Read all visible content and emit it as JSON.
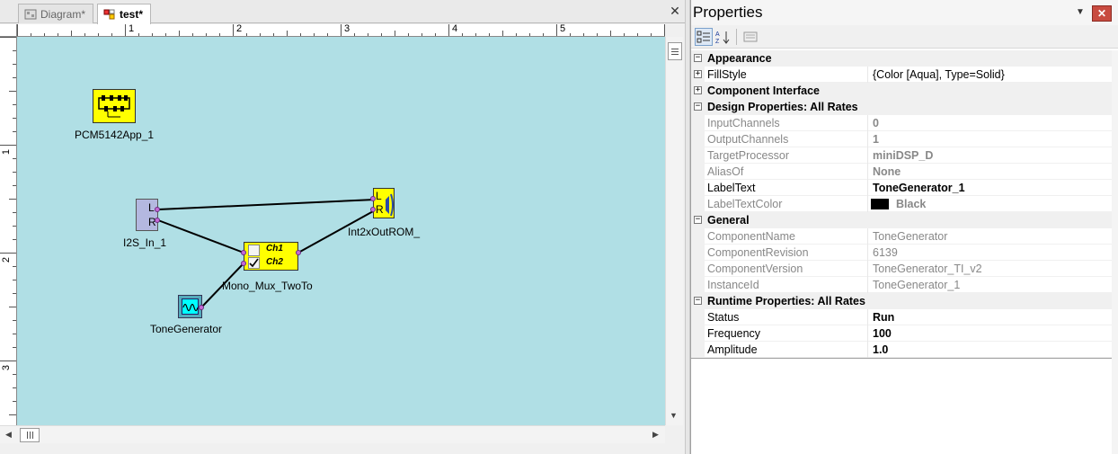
{
  "tabs": [
    {
      "label": "Diagram*",
      "active": false
    },
    {
      "label": "test*",
      "active": true
    }
  ],
  "rulers": {
    "horizontal": [
      "1",
      "2",
      "3",
      "4",
      "5"
    ],
    "vertical": [
      "1",
      "2",
      "3"
    ]
  },
  "diagram": {
    "nodes": {
      "pcm": {
        "label": "PCM5142App_1"
      },
      "i2s": {
        "label": "I2S_In_1",
        "port_l": "L",
        "port_r": "R"
      },
      "out": {
        "label": "Int2xOutROM_",
        "port_l": "L",
        "port_r": "R"
      },
      "mux": {
        "label": "Mono_Mux_TwoTo",
        "ch1": "Ch1",
        "ch2": "Ch2",
        "ch1_checked": false,
        "ch2_checked": true
      },
      "tone": {
        "label": "ToneGenerator"
      }
    },
    "canvas_color": "#b0dfe5",
    "block_color": "#ffff00"
  },
  "properties": {
    "title": "Properties",
    "categories": [
      {
        "name": "Appearance",
        "expanded": true,
        "rows": [
          {
            "name": "FillStyle",
            "value": "{Color [Aqua], Type=Solid}",
            "readonly": false,
            "bold": false,
            "expandable": true
          }
        ]
      },
      {
        "name": "Component Interface",
        "expanded": false,
        "rows": []
      },
      {
        "name": "Design Properties: All Rates",
        "expanded": true,
        "rows": [
          {
            "name": "InputChannels",
            "value": "0",
            "readonly": true,
            "bold": true
          },
          {
            "name": "OutputChannels",
            "value": "1",
            "readonly": true,
            "bold": true
          },
          {
            "name": "TargetProcessor",
            "value": "miniDSP_D",
            "readonly": true,
            "bold": true
          },
          {
            "name": "AliasOf",
            "value": "None",
            "readonly": true,
            "bold": true
          },
          {
            "name": "LabelText",
            "value": "ToneGenerator_1",
            "readonly": false,
            "bold": true
          },
          {
            "name": "LabelTextColor",
            "value": "Black",
            "readonly": true,
            "bold": true,
            "swatch": "#000000"
          }
        ]
      },
      {
        "name": "General",
        "expanded": true,
        "rows": [
          {
            "name": "ComponentName",
            "value": "ToneGenerator",
            "readonly": true,
            "bold": false
          },
          {
            "name": "ComponentRevision",
            "value": "6139",
            "readonly": true,
            "bold": false
          },
          {
            "name": "ComponentVersion",
            "value": "ToneGenerator_TI_v2",
            "readonly": true,
            "bold": false
          },
          {
            "name": "InstanceId",
            "value": "ToneGenerator_1",
            "readonly": true,
            "bold": false
          }
        ]
      },
      {
        "name": "Runtime Properties: All Rates",
        "expanded": true,
        "rows": [
          {
            "name": "Status",
            "value": "Run",
            "readonly": false,
            "bold": true
          },
          {
            "name": "Frequency",
            "value": "100",
            "readonly": false,
            "bold": true
          },
          {
            "name": "Amplitude",
            "value": "1.0",
            "readonly": false,
            "bold": true
          }
        ]
      }
    ]
  }
}
